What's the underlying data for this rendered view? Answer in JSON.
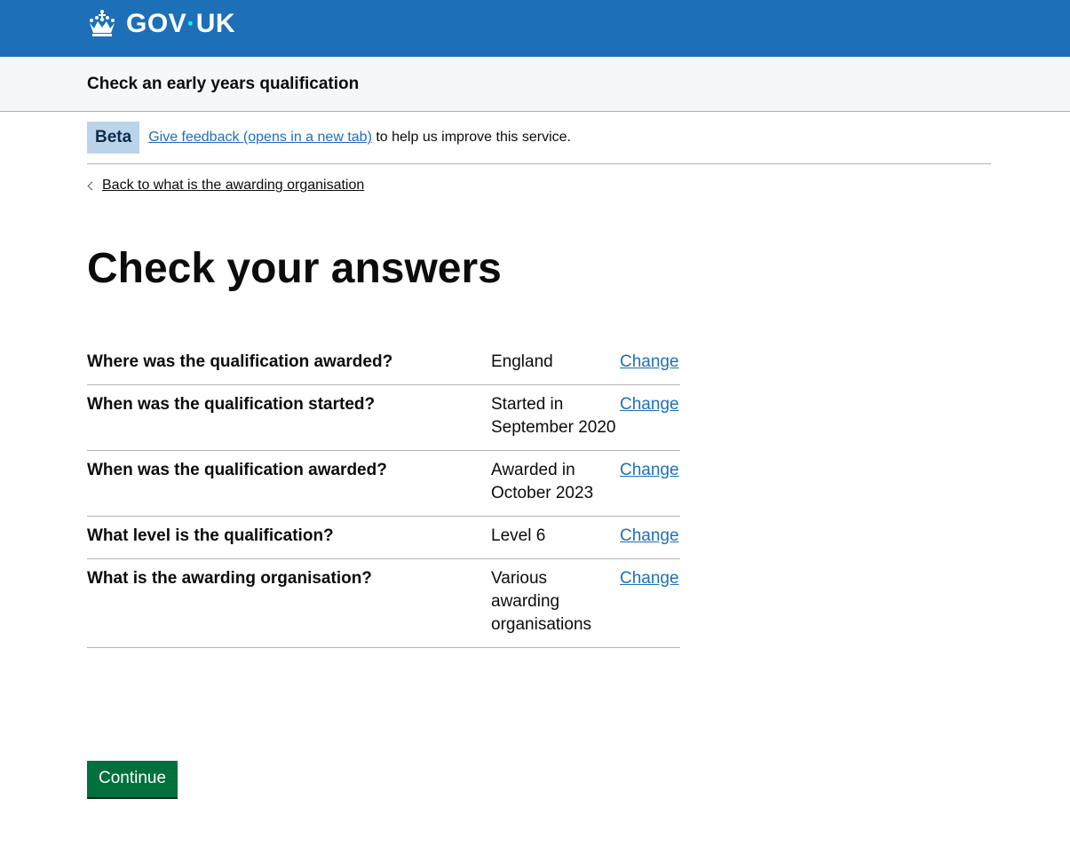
{
  "header": {
    "logo_text_left": "GOV",
    "logo_dot": "·",
    "logo_text_right": "UK",
    "logo_icon": "crown-icon"
  },
  "service": {
    "name": "Check an early years qualification"
  },
  "phase_banner": {
    "tag": "Beta",
    "link_text": "Give feedback (opens in a new tab)",
    "text_after": " to help us improve this service."
  },
  "back_link": {
    "label": "Back to what is the awarding organisation"
  },
  "page": {
    "title": "Check your answers"
  },
  "summary": {
    "rows": [
      {
        "key": "Where was the qualification awarded?",
        "value": "England",
        "action": "Change"
      },
      {
        "key": "When was the qualification started?",
        "value": "Started in September 2020",
        "action": "Change"
      },
      {
        "key": "When was the qualification awarded?",
        "value": "Awarded in October 2023",
        "action": "Change"
      },
      {
        "key": "What level is the qualification?",
        "value": "Level 6",
        "action": "Change"
      },
      {
        "key": "What is the awarding organisation?",
        "value": "Various awarding organisations",
        "action": "Change"
      }
    ]
  },
  "buttons": {
    "continue_label": "Continue"
  },
  "colors": {
    "brand_blue": "#1d70b8",
    "button_green": "#00703c",
    "phase_tag_bg": "#bbd4ea",
    "link": "#1d70b8"
  }
}
